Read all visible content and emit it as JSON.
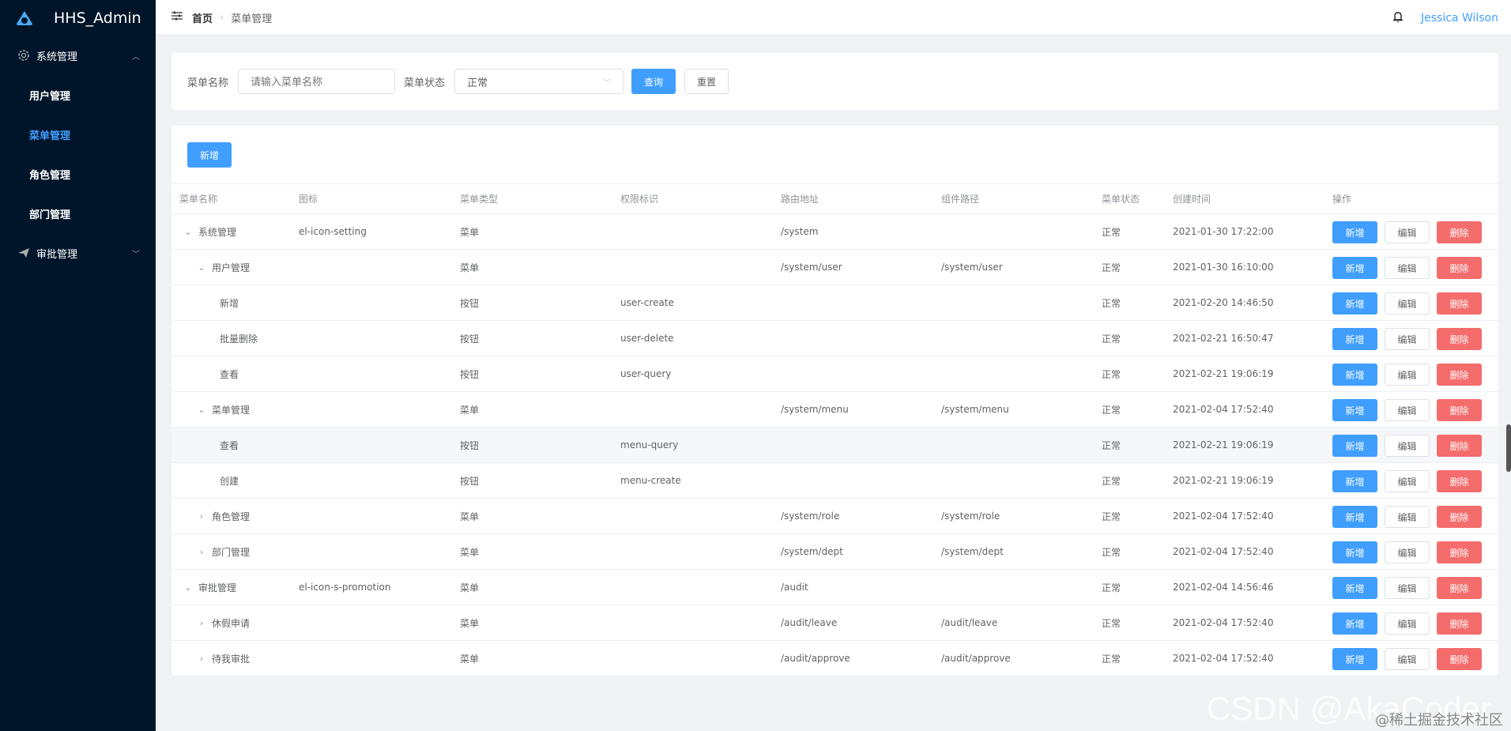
{
  "app": {
    "title": "HHS_Admin"
  },
  "sidebar": {
    "groups": [
      {
        "label": "系统管理",
        "icon": "gear-icon",
        "expanded": true,
        "items": [
          {
            "label": "用户管理"
          },
          {
            "label": "菜单管理",
            "active": true
          },
          {
            "label": "角色管理"
          },
          {
            "label": "部门管理"
          }
        ]
      },
      {
        "label": "审批管理",
        "icon": "send-icon",
        "expanded": false,
        "items": []
      }
    ]
  },
  "header": {
    "breadcrumb": [
      "首页",
      "菜单管理"
    ],
    "user": "Jessica Wilson"
  },
  "search": {
    "name_label": "菜单名称",
    "name_placeholder": "请输入菜单名称",
    "name_value": "",
    "status_label": "菜单状态",
    "status_value": "正常",
    "query": "查询",
    "reset": "重置"
  },
  "toolbar": {
    "add": "新增"
  },
  "table": {
    "columns": [
      "菜单名称",
      "图标",
      "菜单类型",
      "权限标识",
      "路由地址",
      "组件路径",
      "菜单状态",
      "创建时间",
      "操作"
    ],
    "actions": {
      "add": "新增",
      "edit": "编辑",
      "delete": "删除"
    },
    "rows": [
      {
        "level": 0,
        "expand": "open",
        "name": "系统管理",
        "icon": "el-icon-setting",
        "type": "菜单",
        "perm": "",
        "path": "/system",
        "component": "",
        "status": "正常",
        "created": "2021-01-30 17:22:00"
      },
      {
        "level": 1,
        "expand": "open",
        "name": "用户管理",
        "icon": "",
        "type": "菜单",
        "perm": "",
        "path": "/system/user",
        "component": "/system/user",
        "status": "正常",
        "created": "2021-01-30 16:10:00"
      },
      {
        "level": 2,
        "expand": "none",
        "name": "新增",
        "icon": "",
        "type": "按钮",
        "perm": "user-create",
        "path": "",
        "component": "",
        "status": "正常",
        "created": "2021-02-20 14:46:50"
      },
      {
        "level": 2,
        "expand": "none",
        "name": "批量删除",
        "icon": "",
        "type": "按钮",
        "perm": "user-delete",
        "path": "",
        "component": "",
        "status": "正常",
        "created": "2021-02-21 16:50:47"
      },
      {
        "level": 2,
        "expand": "none",
        "name": "查看",
        "icon": "",
        "type": "按钮",
        "perm": "user-query",
        "path": "",
        "component": "",
        "status": "正常",
        "created": "2021-02-21 19:06:19"
      },
      {
        "level": 1,
        "expand": "open",
        "name": "菜单管理",
        "icon": "",
        "type": "菜单",
        "perm": "",
        "path": "/system/menu",
        "component": "/system/menu",
        "status": "正常",
        "created": "2021-02-04 17:52:40"
      },
      {
        "level": 2,
        "expand": "none",
        "name": "查看",
        "icon": "",
        "type": "按钮",
        "perm": "menu-query",
        "path": "",
        "component": "",
        "status": "正常",
        "created": "2021-02-21 19:06:19",
        "hover": true
      },
      {
        "level": 2,
        "expand": "none",
        "name": "创建",
        "icon": "",
        "type": "按钮",
        "perm": "menu-create",
        "path": "",
        "component": "",
        "status": "正常",
        "created": "2021-02-21 19:06:19"
      },
      {
        "level": 1,
        "expand": "closed",
        "name": "角色管理",
        "icon": "",
        "type": "菜单",
        "perm": "",
        "path": "/system/role",
        "component": "/system/role",
        "status": "正常",
        "created": "2021-02-04 17:52:40"
      },
      {
        "level": 1,
        "expand": "closed",
        "name": "部门管理",
        "icon": "",
        "type": "菜单",
        "perm": "",
        "path": "/system/dept",
        "component": "/system/dept",
        "status": "正常",
        "created": "2021-02-04 17:52:40"
      },
      {
        "level": 0,
        "expand": "open",
        "name": "审批管理",
        "icon": "el-icon-s-promotion",
        "type": "菜单",
        "perm": "",
        "path": "/audit",
        "component": "",
        "status": "正常",
        "created": "2021-02-04 14:56:46"
      },
      {
        "level": 1,
        "expand": "closed",
        "name": "休假申请",
        "icon": "",
        "type": "菜单",
        "perm": "",
        "path": "/audit/leave",
        "component": "/audit/leave",
        "status": "正常",
        "created": "2021-02-04 17:52:40"
      },
      {
        "level": 1,
        "expand": "closed",
        "name": "待我审批",
        "icon": "",
        "type": "菜单",
        "perm": "",
        "path": "/audit/approve",
        "component": "/audit/approve",
        "status": "正常",
        "created": "2021-02-04 17:52:40"
      }
    ]
  },
  "watermark": {
    "main": "CSDN @AkaCoder",
    "sub": "@稀土掘金技术社区"
  },
  "colors": {
    "sidebar": "#001529",
    "primary": "#409eff",
    "danger": "#f56c6c",
    "background": "#f0f2f5"
  }
}
